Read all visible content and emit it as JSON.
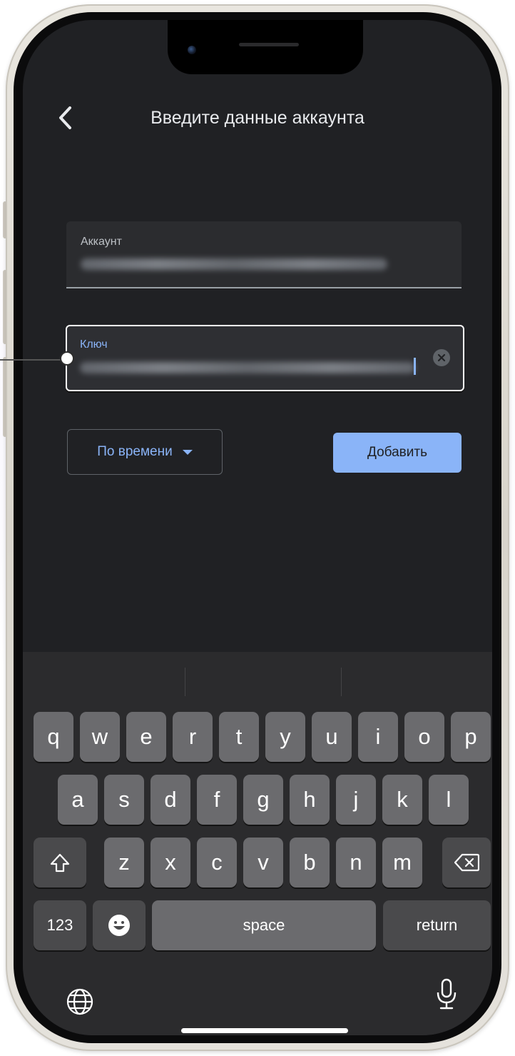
{
  "header": {
    "title": "Введите данные аккаунта"
  },
  "fields": {
    "account": {
      "label": "Аккаунт"
    },
    "key": {
      "label": "Ключ"
    }
  },
  "buttons": {
    "mode_label": "По времени",
    "add_label": "Добавить"
  },
  "keyboard": {
    "row1": [
      "q",
      "w",
      "e",
      "r",
      "t",
      "y",
      "u",
      "i",
      "o",
      "p"
    ],
    "row2": [
      "a",
      "s",
      "d",
      "f",
      "g",
      "h",
      "j",
      "k",
      "l"
    ],
    "row3": [
      "z",
      "x",
      "c",
      "v",
      "b",
      "n",
      "m"
    ],
    "numbers_label": "123",
    "space_label": "space",
    "return_label": "return"
  },
  "colors": {
    "accent": "#8ab4f8",
    "background": "#202124",
    "field": "#2b2c2f"
  },
  "icons": [
    "back-chevron-icon",
    "clear-icon",
    "dropdown-triangle-icon",
    "shift-icon",
    "backspace-icon",
    "emoji-icon",
    "globe-icon",
    "microphone-icon"
  ]
}
